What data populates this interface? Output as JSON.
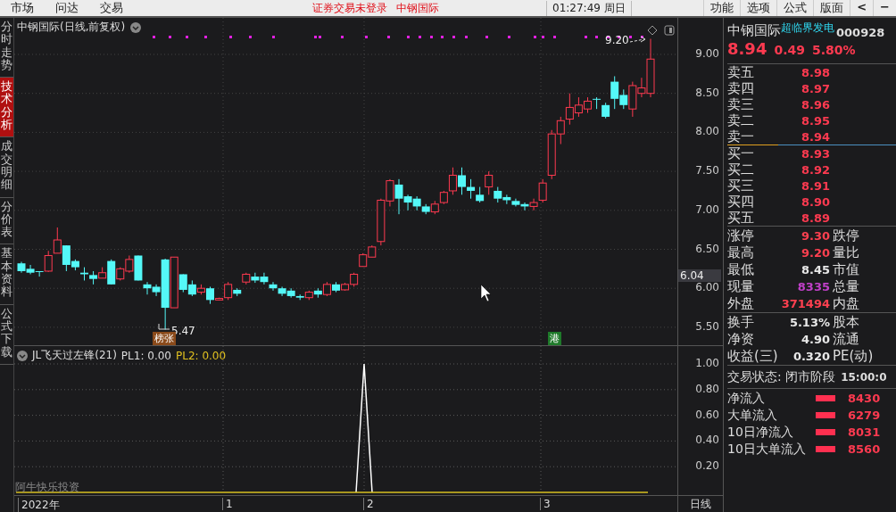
{
  "top_bar": {
    "menu": [
      "市场",
      "问达",
      "交易"
    ],
    "notice": "证券交易未登录",
    "notice_stock": "中钢国际",
    "clock": "01:27:49 周日",
    "right_menu": [
      "功能",
      "选项",
      "公式",
      "版面"
    ],
    "back_button": "<",
    "minimize_button": "−"
  },
  "sidebar": {
    "tabs": [
      {
        "label": "分时走势",
        "selected": false
      },
      {
        "label": "技术分析",
        "selected": true
      },
      {
        "label": "成交明细",
        "selected": false
      },
      {
        "label": "分价表",
        "selected": false
      },
      {
        "label": "基本资料",
        "selected": false
      },
      {
        "label": "公式下载",
        "selected": false
      }
    ]
  },
  "chart": {
    "title": "中钢国际(日线,前复权)",
    "price_axis": [
      "9.00",
      "8.50",
      "8.00",
      "7.50",
      "7.00",
      "6.50",
      "6.00",
      "5.50"
    ],
    "current_price_tag": "6.04",
    "low_label": "5.47",
    "high_label": "9.20",
    "badges": [
      {
        "text": "榜张",
        "kind": "limit"
      },
      {
        "text": "港",
        "kind": "hk"
      }
    ]
  },
  "indicator": {
    "name": "JL飞天过左锋(21)",
    "pl1": "PL1: 0.00",
    "pl2": "PL2: 0.00",
    "axis": [
      "1.00",
      "0.80",
      "0.60",
      "0.40",
      "0.20"
    ],
    "author": "阿牛快乐投资"
  },
  "time_axis": {
    "labels": [
      "2022年",
      "1",
      "2",
      "3"
    ],
    "period": "日线"
  },
  "quote": {
    "name": "中钢国际",
    "concept": "超临界发电",
    "code": "000928",
    "price": "8.94",
    "change": "0.49",
    "percent": "5.80%",
    "sells": [
      {
        "label": "卖五",
        "price": "8.98"
      },
      {
        "label": "卖四",
        "price": "8.97"
      },
      {
        "label": "卖三",
        "price": "8.96"
      },
      {
        "label": "卖二",
        "price": "8.95"
      },
      {
        "label": "卖一",
        "price": "8.94"
      }
    ],
    "buys": [
      {
        "label": "买一",
        "price": "8.93"
      },
      {
        "label": "买二",
        "price": "8.92"
      },
      {
        "label": "买三",
        "price": "8.91"
      },
      {
        "label": "买四",
        "price": "8.90"
      },
      {
        "label": "买五",
        "price": "8.89"
      }
    ],
    "stats": [
      {
        "label": "涨停",
        "value": "9.30",
        "color": "#ff4050",
        "label2": "跌停"
      },
      {
        "label": "最高",
        "value": "9.20",
        "color": "#ff4050",
        "label2": "量比"
      },
      {
        "label": "最低",
        "value": "8.45",
        "color": "#e8e8e8",
        "label2": "市值"
      },
      {
        "label": "现量",
        "value": "8335",
        "color": "#c040c8",
        "label2": "总量"
      },
      {
        "label": "外盘",
        "value": "371494",
        "color": "#ff4050",
        "label2": "内盘"
      }
    ],
    "stats2": [
      {
        "label": "换手",
        "value": "5.13%",
        "label2": "股本"
      },
      {
        "label": "净资",
        "value": "4.90",
        "label2": "流通"
      },
      {
        "label": "收益(三)",
        "value": "0.320",
        "label2": "PE(动)"
      }
    ],
    "status": "交易状态: 闭市阶段",
    "status_time": "15:00:0",
    "flows": [
      {
        "label": "净流入",
        "value": "8430"
      },
      {
        "label": "大单流入",
        "value": "6279"
      },
      {
        "label": "10日净流入",
        "value": "8031"
      },
      {
        "label": "10日大单流入",
        "value": "8560"
      }
    ]
  }
}
